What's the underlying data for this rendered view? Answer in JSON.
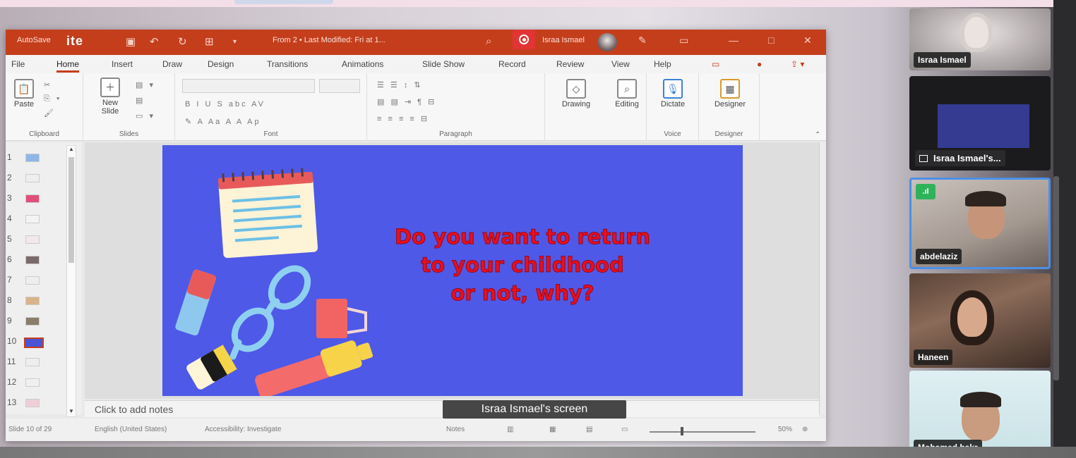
{
  "titlebar": {
    "autosave_label": "AutoSave",
    "logo_text": "ite",
    "title": "From 2 • Last Modified: Fri at 1...",
    "user_name": "Israa Ismael"
  },
  "ribbon_tabs": [
    "File",
    "Home",
    "Insert",
    "Draw",
    "Design",
    "Transitions",
    "Animations",
    "Slide Show",
    "Record",
    "Review",
    "View",
    "Help"
  ],
  "ribbon": {
    "clipboard": {
      "paste": "Paste",
      "label": "Clipboard"
    },
    "slides": {
      "new_slide": "New",
      "new_slide2": "Slide",
      "label": "Slides"
    },
    "font": {
      "label": "Font"
    },
    "paragraph": {
      "label": "Paragraph"
    },
    "drawing": {
      "label": "Drawing"
    },
    "editing": {
      "label": "Editing"
    },
    "voice": {
      "dictate": "Dictate",
      "label": "Voice"
    },
    "designer": {
      "button": "Designer",
      "label": "Designer"
    }
  },
  "thumbnails": {
    "numbers": [
      "1",
      "2",
      "3",
      "4",
      "5",
      "6",
      "7",
      "8",
      "9",
      "10",
      "11",
      "12",
      "13"
    ],
    "selected": "10"
  },
  "slide": {
    "line1": "Do you want to return",
    "line2": "to your childhood",
    "line3": "or not, why?"
  },
  "notes_placeholder": "Click to add notes",
  "status": {
    "slide_count": "Slide 10 of 29",
    "language": "English (United States)",
    "accessibility": "Accessibility: Investigate",
    "notes": "Notes",
    "zoom": "50%"
  },
  "screen_share_label": "Israa Ismael's screen",
  "participants": [
    {
      "name": "Israa Ismael"
    },
    {
      "name": "Israa Ismael's..."
    },
    {
      "name": "abdelaziz"
    },
    {
      "name": "Haneen"
    },
    {
      "name": "Mohamed bakr"
    }
  ],
  "colors": {
    "ppt_accent": "#c43e1c",
    "slide_bg": "#4e59e8",
    "slide_text": "#e80f1f",
    "active_speaker_border": "#4c8fe8"
  }
}
